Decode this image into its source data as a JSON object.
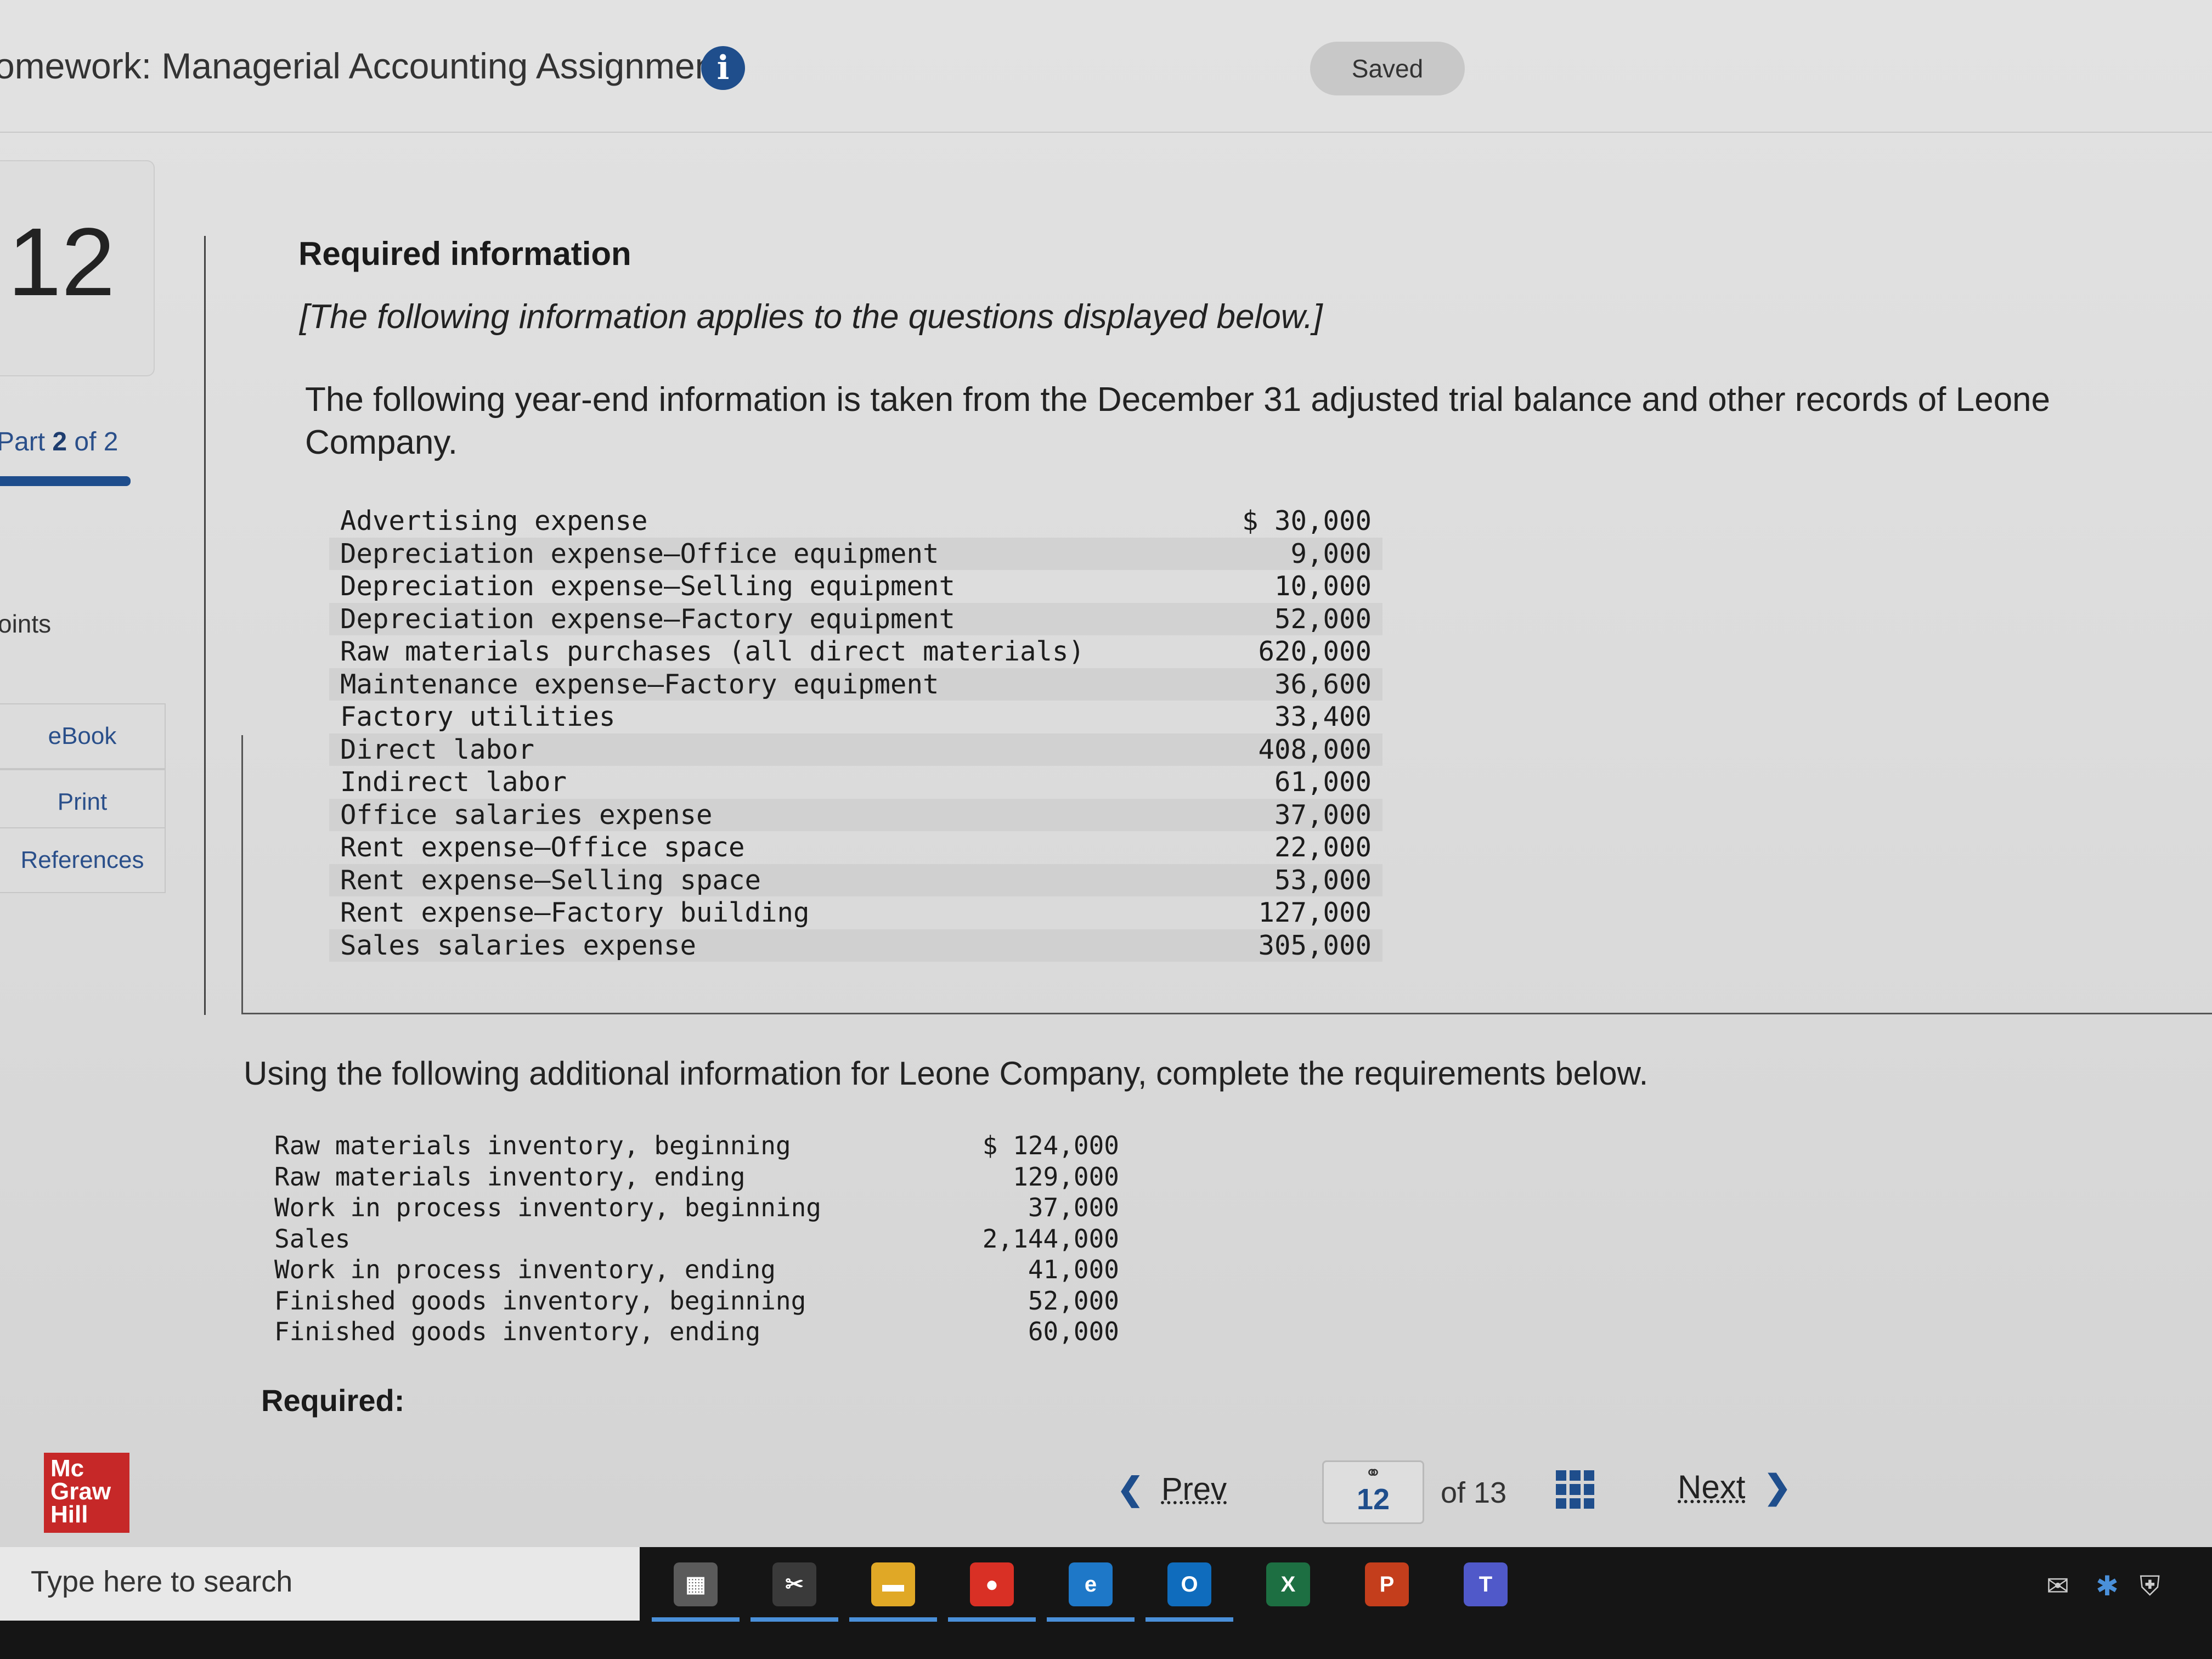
{
  "header": {
    "title": "omework: Managerial Accounting Assignment",
    "info_icon": "i",
    "status": "Saved"
  },
  "sidebar": {
    "question_number": "12",
    "part_prefix": "Part",
    "part_current": "2",
    "part_suffix": "of 2",
    "points_label": "oints",
    "buttons": [
      "eBook",
      "Print",
      "References"
    ]
  },
  "content": {
    "required_info_heading": "Required information",
    "note": "[The following information applies to the questions displayed below.]",
    "intro": "The following year-end information is taken from the December 31 adjusted trial balance and other records of Leone Company.",
    "trial_balance": [
      {
        "label": "Advertising expense",
        "value": "$ 30,000"
      },
      {
        "label": "Depreciation expense—Office equipment",
        "value": "9,000"
      },
      {
        "label": "Depreciation expense—Selling equipment",
        "value": "10,000"
      },
      {
        "label": "Depreciation expense—Factory equipment",
        "value": "52,000"
      },
      {
        "label": "Raw materials purchases (all direct materials)",
        "value": "620,000"
      },
      {
        "label": "Maintenance expense—Factory equipment",
        "value": "36,600"
      },
      {
        "label": "Factory utilities",
        "value": "33,400"
      },
      {
        "label": "Direct labor",
        "value": "408,000"
      },
      {
        "label": "Indirect labor",
        "value": "61,000"
      },
      {
        "label": "Office salaries expense",
        "value": "37,000"
      },
      {
        "label": "Rent expense—Office space",
        "value": "22,000"
      },
      {
        "label": "Rent expense—Selling space",
        "value": "53,000"
      },
      {
        "label": "Rent expense—Factory building",
        "value": "127,000"
      },
      {
        "label": "Sales salaries expense",
        "value": "305,000"
      }
    ],
    "additional_intro": "Using the following additional information for Leone Company, complete the requirements below.",
    "additional": [
      {
        "label": "Raw materials inventory, beginning",
        "value": "$ 124,000"
      },
      {
        "label": "Raw materials inventory, ending",
        "value": "129,000"
      },
      {
        "label": "Work in process inventory, beginning",
        "value": "37,000"
      },
      {
        "label": "Sales",
        "value": "2,144,000"
      },
      {
        "label": "Work in process inventory, ending",
        "value": "41,000"
      },
      {
        "label": "Finished goods inventory, beginning",
        "value": "52,000"
      },
      {
        "label": "Finished goods inventory, ending",
        "value": "60,000"
      }
    ],
    "required_label": "Required:"
  },
  "footer": {
    "logo_lines": [
      "Mc",
      "Graw",
      "Hill"
    ],
    "prev_label": "Prev",
    "current_page": "12",
    "of_label": "of 13",
    "next_label": "Next"
  },
  "taskbar": {
    "search_placeholder": "Type here to search",
    "apps": [
      {
        "name": "calculator-icon",
        "glyph": "▦",
        "color": "#5b5b5b"
      },
      {
        "name": "snipping-tool-icon",
        "glyph": "✂",
        "color": "#3a3a3a"
      },
      {
        "name": "file-explorer-icon",
        "glyph": "▬",
        "color": "#e0a826"
      },
      {
        "name": "chrome-icon",
        "glyph": "●",
        "color": "#d93025"
      },
      {
        "name": "edge-icon",
        "glyph": "e",
        "color": "#1e78c8"
      },
      {
        "name": "outlook-icon",
        "glyph": "O",
        "color": "#0f6cbd"
      },
      {
        "name": "excel-icon",
        "glyph": "X",
        "color": "#1d6f42"
      },
      {
        "name": "powerpoint-icon",
        "glyph": "P",
        "color": "#c43e1c"
      },
      {
        "name": "teams-icon",
        "glyph": "T",
        "color": "#5059c9"
      }
    ]
  },
  "colors": {
    "accent": "#1f4e8c",
    "logo": "#c62828"
  }
}
